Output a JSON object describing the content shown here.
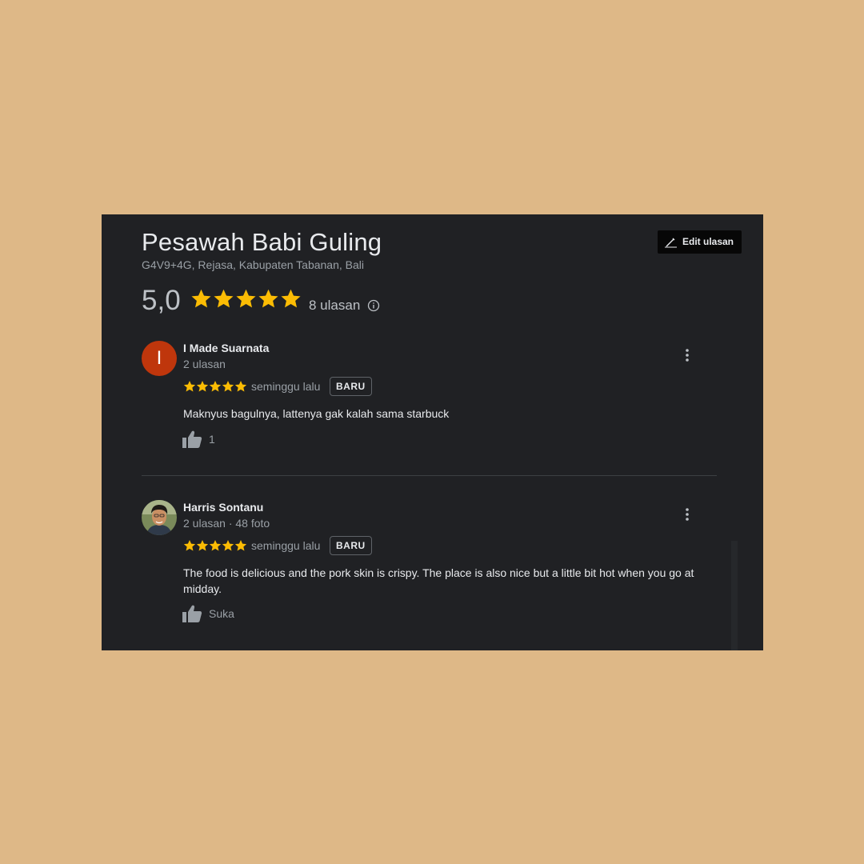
{
  "place": {
    "name": "Pesawah Babi Guling",
    "address": "G4V9+4G, Rejasa, Kabupaten Tabanan, Bali",
    "rating": "5,0",
    "rating_stars": 5,
    "review_count": "8 ulasan",
    "edit_button_label": "Edit ulasan"
  },
  "colors": {
    "background": "#deb887",
    "panel": "#202124",
    "star": "#fbbc04",
    "avatar_letter_bg": "#bf360c"
  },
  "reviews": [
    {
      "avatar_letter": "I",
      "name": "I Made Suarnata",
      "meta": "2 ulasan",
      "stars": 5,
      "time": "seminggu lalu",
      "badge": "BARU",
      "text": "Maknyus bagulnya, lattenya gak kalah sama starbuck",
      "like_label": "1"
    },
    {
      "avatar_icon": "user-photo",
      "name": "Harris Sontanu",
      "meta": "2 ulasan · 48 foto",
      "stars": 5,
      "time": "seminggu lalu",
      "badge": "BARU",
      "text": "The food is delicious and the pork skin is crispy. The place is also nice but a little bit hot when you go at midday.",
      "like_label": "Suka"
    }
  ]
}
